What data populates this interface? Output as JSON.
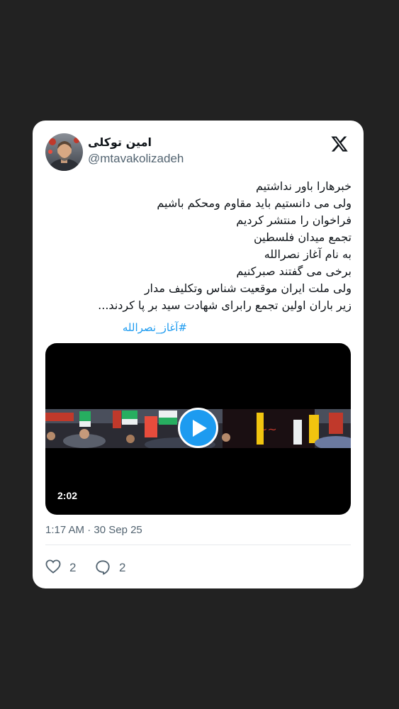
{
  "author": {
    "display_name": "امین توکلی",
    "handle": "@mtavakolizadeh"
  },
  "logo_icon": "x-logo-icon",
  "tweet": {
    "lines": [
      "خبرهارا باور نداشتیم",
      "ولی می دانستیم باید مقاوم ومحکم باشیم",
      "فراخوان را منتشر کردیم",
      "تجمع میدان فلسطین",
      "به نام آغاز نصرالله",
      "برخی می گفتند صبرکنیم",
      "ولی ملت ایران موقعیت شناس وتکلیف مدار",
      "زیر باران اولین تجمع رابرای شهادت سید بر پا کردند..."
    ],
    "hashtag": "#آغاز_نصرالله"
  },
  "video": {
    "duration": "2:02",
    "play_icon": "play-icon"
  },
  "timestamp": "1:17 AM · 30 Sep 25",
  "actions": {
    "likes": "2",
    "replies": "2"
  },
  "colors": {
    "page_background": "#222222",
    "card_background": "#ffffff",
    "accent": "#1d9bf0",
    "text_primary": "#0f1419",
    "text_secondary": "#536471"
  }
}
